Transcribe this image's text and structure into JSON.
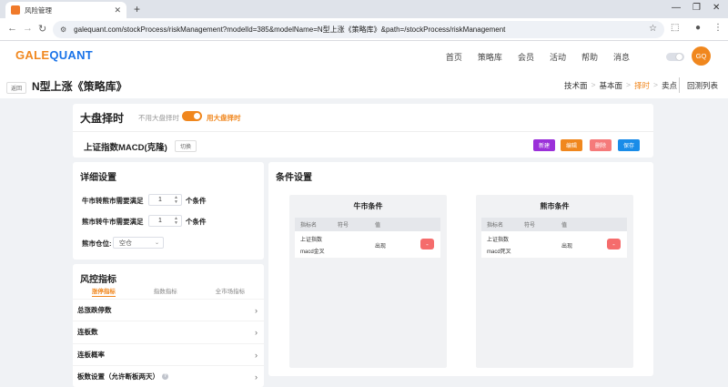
{
  "browser": {
    "tab_title": "风险管理",
    "url": "galequant.com/stockProcess/riskManagement?modelId=385&modelName=N型上涨《策略库》&path=/stockProcess/riskManagement"
  },
  "header": {
    "logo_part1": "GALE",
    "logo_part2": "QUANT",
    "nav": [
      "首页",
      "策略库",
      "会员",
      "活动",
      "帮助",
      "消息"
    ],
    "avatar_text": "GQ"
  },
  "titlebar": {
    "back_label": "返回",
    "page_title": "N型上涨《策略库》",
    "breadcrumbs": [
      "技术面",
      "基本面",
      "择时",
      "卖点"
    ],
    "sep": ">",
    "backtest_label": "回测列表"
  },
  "market": {
    "title": "大盘择时",
    "off_label": "不用大盘择时",
    "on_label": "用大盘择时",
    "strategy_name": "上证指数MACD(克隆)",
    "switch_label": "切换",
    "buttons": {
      "new": "新建",
      "edit": "编辑",
      "delete": "删除",
      "save": "保存"
    }
  },
  "colors": {
    "new": "#9b30d9",
    "edit": "#f0871e",
    "delete": "#f57a7a",
    "save": "#1a8ce8"
  },
  "detail": {
    "title": "详细设置",
    "bull_label": "牛市转熊市需要满足",
    "bull_value": "1",
    "bear_label": "熊市转牛市需要满足",
    "bear_value": "1",
    "unit": "个条件",
    "position_label": "熊市仓位:",
    "position_value": "空仓"
  },
  "risk": {
    "title": "风控指标",
    "tabs": [
      "涨停指标",
      "指数指标",
      "全市场指标"
    ],
    "rows": [
      "总涨跌停数",
      "连板数",
      "连板概率",
      "板数设置（允许断板两天）"
    ]
  },
  "conditions": {
    "title": "条件设置",
    "headers": [
      "指标名",
      "符号",
      "值"
    ],
    "bull": {
      "title": "牛市条件",
      "name_line1": "上证指数",
      "name_line2": "macd金叉",
      "value": "出现",
      "delete": "-"
    },
    "bear": {
      "title": "熊市条件",
      "name_line1": "上证指数",
      "name_line2": "macd死叉",
      "value": "出现",
      "delete": "-"
    }
  }
}
